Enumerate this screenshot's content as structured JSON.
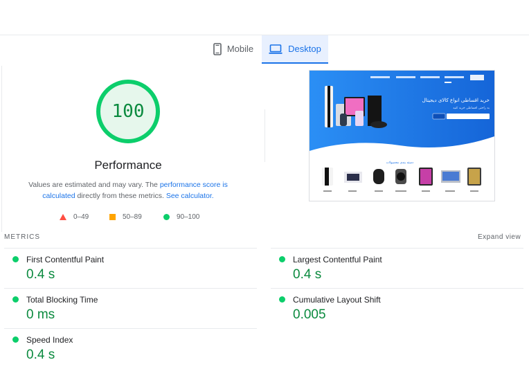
{
  "tabs": {
    "mobile_label": "Mobile",
    "desktop_label": "Desktop",
    "active": "Desktop"
  },
  "gauge": {
    "score": "100",
    "score_fraction": 1.0,
    "color": "#0cce6b"
  },
  "performance": {
    "title": "Performance",
    "desc_part1": "Values are estimated and may vary. The ",
    "desc_link1": "performance score is calculated",
    "desc_part2": " directly from these metrics. ",
    "desc_link2": "See calculator."
  },
  "legend": {
    "fail": "0–49",
    "average": "50–89",
    "pass": "90–100"
  },
  "colors": {
    "pass": "#0cce6b",
    "average": "#ffa400",
    "fail": "#ff4e42",
    "accent": "#1a73e8",
    "pass_text": "#0a8a3e"
  },
  "screenshot": {
    "hero_title": "خرید اقساطی انواع کالای دیجیتال",
    "hero_subtitle": "به راحتی اقساطی خرید کنید",
    "section_title": "دسته بندی محصولات"
  },
  "metrics": {
    "heading": "METRICS",
    "expand_label": "Expand view",
    "items": [
      {
        "label": "First Contentful Paint",
        "value": "0.4 s"
      },
      {
        "label": "Total Blocking Time",
        "value": "0 ms"
      },
      {
        "label": "Speed Index",
        "value": "0.4 s"
      },
      {
        "label": "Largest Contentful Paint",
        "value": "0.4 s"
      },
      {
        "label": "Cumulative Layout Shift",
        "value": "0.005"
      }
    ]
  }
}
